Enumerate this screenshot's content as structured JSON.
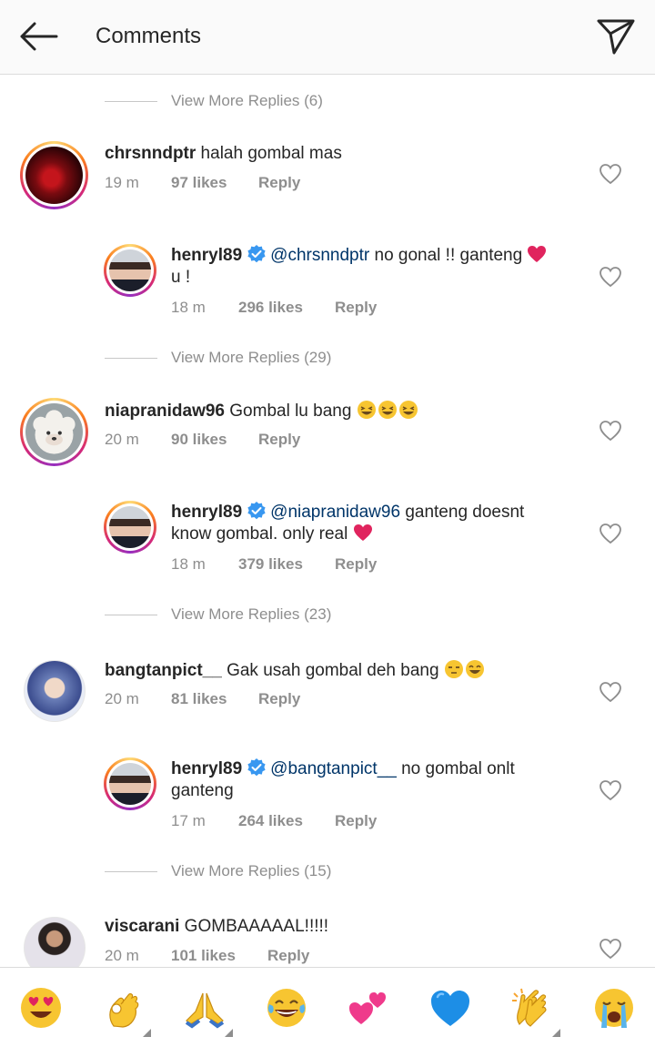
{
  "header": {
    "title": "Comments",
    "back_icon": "arrow-left-icon",
    "send_icon": "paper-plane-icon"
  },
  "comments": [
    {
      "more": "View More Replies (6)"
    },
    {
      "user": "chrsnndptr",
      "text": " halah gombal mas",
      "time": "19 m",
      "likes": "97 likes",
      "reply": "Reply"
    },
    {
      "user": "henryl89",
      "mention": "@chrsnndptr",
      "text": " no gonal !! ganteng ",
      "text2": "u !",
      "time": "18 m",
      "likes": "296 likes",
      "reply": "Reply"
    },
    {
      "more": "View More Replies (29)"
    },
    {
      "user": "niapranidaw96",
      "text": " Gombal lu bang ",
      "time": "20 m",
      "likes": "90 likes",
      "reply": "Reply"
    },
    {
      "user": "henryl89",
      "mention": "@niapranidaw96",
      "text": " ganteng doesnt",
      "text2": "know gombal. only real ",
      "time": "18 m",
      "likes": "379 likes",
      "reply": "Reply"
    },
    {
      "more": "View More Replies (23)"
    },
    {
      "user": "bangtanpict__",
      "text": " Gak usah gombal deh bang ",
      "time": "20 m",
      "likes": "81 likes",
      "reply": "Reply"
    },
    {
      "user": "henryl89",
      "mention": "@bangtanpict__",
      "text": " no gombal onlt",
      "text2": "ganteng",
      "time": "17 m",
      "likes": "264 likes",
      "reply": "Reply"
    },
    {
      "more": "View More Replies (15)"
    },
    {
      "user": "viscarani",
      "text": " GOMBAAAAAL!!!!!",
      "time": "20 m",
      "likes": "101 likes",
      "reply": "Reply"
    }
  ],
  "emoji_bar": [
    "heart-eyes-emoji",
    "ok-hand-emoji",
    "folded-hands-emoji",
    "tears-of-joy-emoji",
    "two-hearts-emoji",
    "blue-heart-emoji",
    "clapping-hands-emoji",
    "crying-emoji"
  ],
  "colors": {
    "mention": "#003569",
    "secondary": "#8e8e8e",
    "verified": "#3897f0",
    "heart": "#e0245e"
  }
}
